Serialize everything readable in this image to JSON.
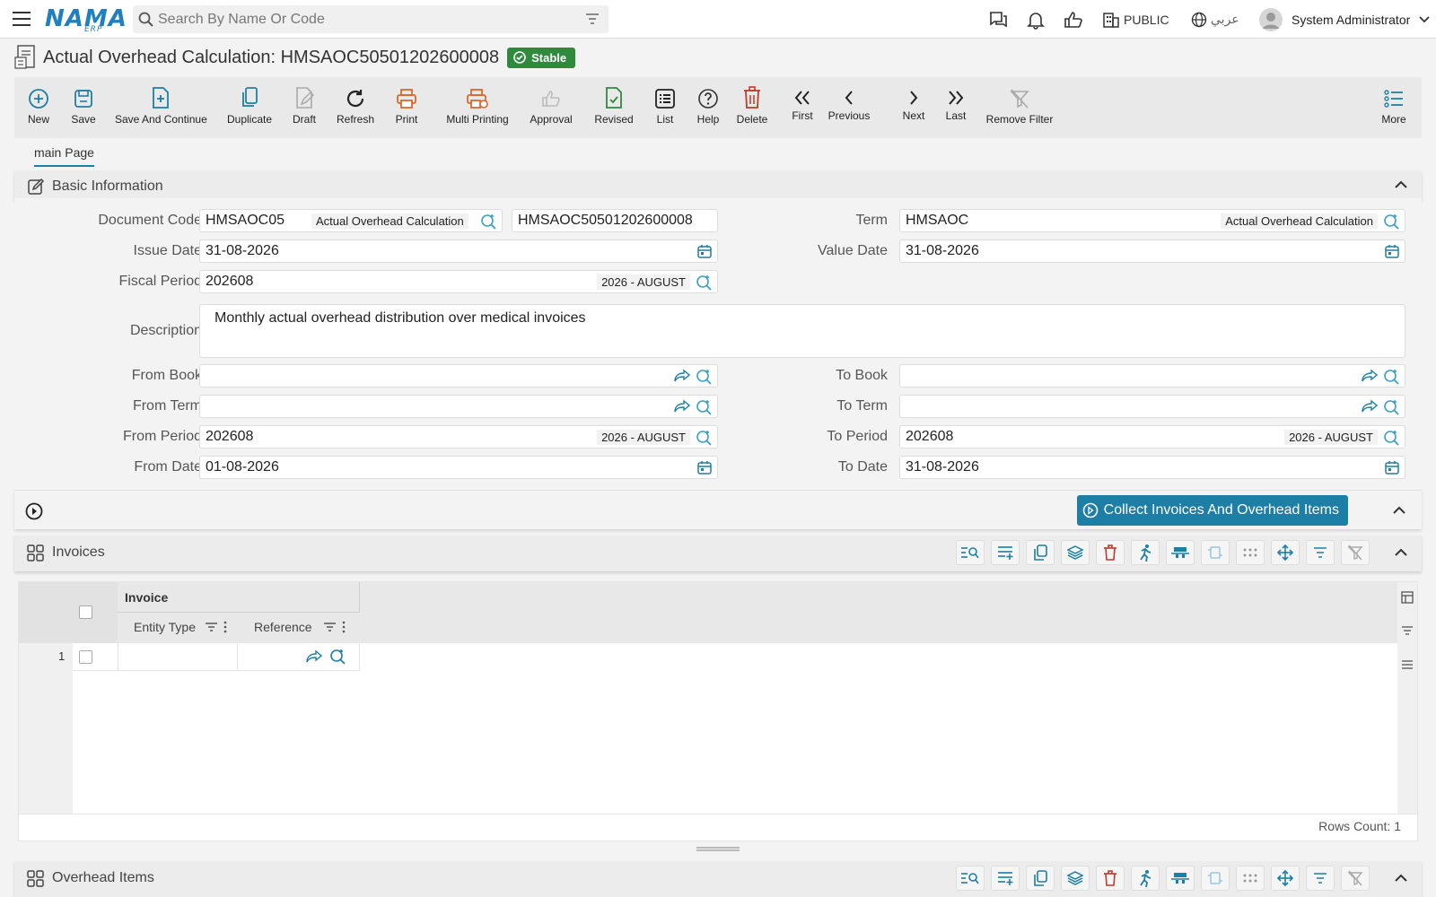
{
  "header": {
    "logo_text": "NAMA",
    "logo_sub": "ERP",
    "search_placeholder": "Search By Name Or Code",
    "public_label": "PUBLIC",
    "language_label": "عربي",
    "user_name": "System Administrator"
  },
  "page": {
    "title": "Actual Overhead Calculation: HMSAOC50501202600008",
    "status_badge": "Stable"
  },
  "toolbar": {
    "new": "New",
    "save": "Save",
    "save_continue": "Save And Continue",
    "duplicate": "Duplicate",
    "draft": "Draft",
    "refresh": "Refresh",
    "print": "Print",
    "multi_printing": "Multi Printing",
    "approval": "Approval",
    "revised": "Revised",
    "list": "List",
    "help": "Help",
    "delete": "Delete",
    "first": "First",
    "previous": "Previous",
    "next": "Next",
    "last": "Last",
    "remove_filter": "Remove Filter",
    "more": "More"
  },
  "tabs": {
    "main": "main Page"
  },
  "basic_info": {
    "section_title": "Basic Information",
    "labels": {
      "document_code": "Document Code",
      "term": "Term",
      "issue_date": "Issue Date",
      "value_date": "Value Date",
      "fiscal_period": "Fiscal Period",
      "description": "Description",
      "from_book": "From Book",
      "to_book": "To Book",
      "from_term": "From Term",
      "to_term": "To Term",
      "from_period": "From Period",
      "to_period": "To Period",
      "from_date": "From Date",
      "to_date": "To Date"
    },
    "values": {
      "document_code": "HMSAOC05",
      "document_code_name": "Actual Overhead Calculation",
      "document_number": "HMSAOC50501202600008",
      "term": "HMSAOC",
      "term_name": "Actual Overhead Calculation",
      "issue_date": "31-08-2026",
      "value_date": "31-08-2026",
      "fiscal_period": "202608",
      "fiscal_period_name": "2026 - AUGUST",
      "description": "Monthly actual overhead distribution over medical invoices",
      "from_book": "",
      "to_book": "",
      "from_term": "",
      "to_term": "",
      "from_period": "202608",
      "from_period_name": "2026 - AUGUST",
      "to_period": "202608",
      "to_period_name": "2026 - AUGUST",
      "from_date": "01-08-2026",
      "to_date": "31-08-2026"
    }
  },
  "actions": {
    "collect_button": "Collect Invoices And Overhead Items"
  },
  "invoices": {
    "section_title": "Invoices",
    "group_header": "Invoice",
    "columns": [
      "Entity Type",
      "Reference"
    ],
    "rows": [
      {
        "index": "1",
        "entity_type": "",
        "reference": ""
      }
    ],
    "rows_count": "Rows Count: 1"
  },
  "overhead_items": {
    "section_title": "Overhead Items"
  },
  "colors": {
    "accent": "#1d7fa6",
    "success": "#2e8b3e",
    "danger": "#c0392b",
    "print_orange": "#e0662a"
  }
}
